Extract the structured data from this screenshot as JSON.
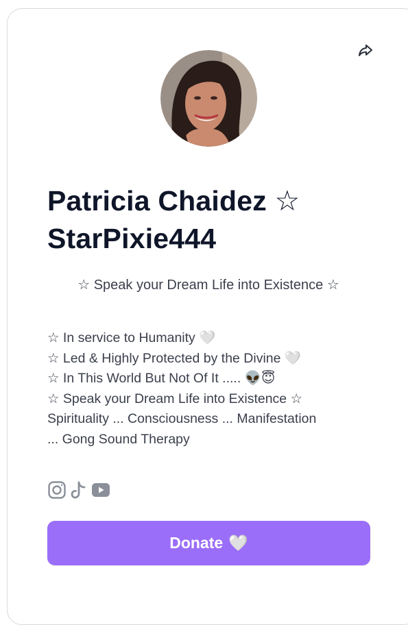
{
  "profile": {
    "name_line1": "Patricia Chaidez ☆",
    "name_line2": "StarPixie444",
    "tagline": "☆ Speak your Dream Life into Existence ☆",
    "bio_lines": [
      "☆ In service to Humanity 🤍",
      "☆ Led & Highly Protected by the Divine 🤍",
      "☆ In This World But Not Of It ..... 👽😇",
      "☆ Speak your Dream Life into Existence ☆",
      "Spirituality ... Consciousness ... Manifestation",
      "... Gong Sound Therapy"
    ]
  },
  "icons": {
    "share": "share-icon",
    "socials": [
      "instagram-icon",
      "tiktok-icon",
      "youtube-icon"
    ]
  },
  "donate": {
    "label": "Donate",
    "emoji": "🤍"
  },
  "colors": {
    "accent": "#9b6ef9",
    "name_text": "#0f1629",
    "body_text": "#3b3f4c",
    "social_icon": "#8a8f99",
    "card_border": "#d9d9de"
  }
}
